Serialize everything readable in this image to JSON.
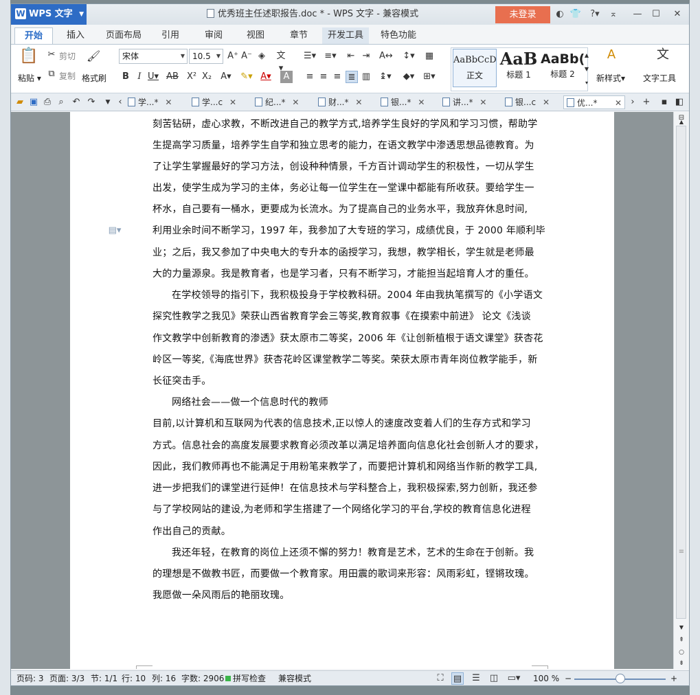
{
  "titlebar": {
    "app_name": "WPS 文字",
    "doc_title": "优秀班主任述职报告.doc * - WPS 文字 - 兼容模式",
    "login_label": "未登录"
  },
  "ribbon_tabs": [
    "开始",
    "插入",
    "页面布局",
    "引用",
    "审阅",
    "视图",
    "章节",
    "开发工具",
    "特色功能"
  ],
  "ribbon": {
    "paste_label": "粘贴",
    "cut_label": "剪切",
    "copy_label": "复制",
    "format_painter_label": "格式刷",
    "font_name": "宋体",
    "font_size": "10.5",
    "style_normal_preview": "AaBbCcD",
    "style_normal_label": "正文",
    "style_h1_preview": "AaB",
    "style_h1_label": "标题 1",
    "style_h2_preview": "AaBb(",
    "style_h2_label": "标题 2",
    "new_style_label": "新样式",
    "text_tools_label": "文字工具"
  },
  "doc_tabs": [
    "学...*",
    "学...c",
    "纪...*",
    "财...*",
    "银...*",
    "讲...*",
    "银...c",
    "优...*"
  ],
  "document": {
    "lines": [
      "刻苦钻研，虚心求教，不断改进自己的教学方式,培养学生良好的学风和学习习惯，帮助学",
      "生提高学习质量，培养学生自学和独立思考的能力，在语文教学中渗透思想品德教育。为",
      "了让学生掌握最好的学习方法，创设种种情景，千方百计调动学生的积极性，一切从学生",
      "出发，使学生成为学习的主体，务必让每一位学生在一堂课中都能有所收获。要给学生一",
      "杯水，自己要有一桶水，更要成为长流水。为了提高自己的业务水平，我放弃休息时间,",
      "利用业余时间不断学习，1997 年，我参加了大专班的学习，成绩优良，于 2000 年顺利毕",
      "业；之后，我又参加了中央电大的专升本的函授学习，我想，教学相长，学生就是老师最",
      "大的力量源泉。我是教育者，也是学习者，只有不断学习，才能担当起培育人才的重任。",
      "在学校领导的指引下，我积极投身于学校教科研。2004 年由我执笔撰写的《小学语文",
      "探究性教学之我见》荣获山西省教育学会三等奖,教育叙事《在摸索中前进》 论文《浅谈",
      "作文教学中创新教育的渗透》获太原市二等奖，2006 年《让创新植根于语文课堂》获杏花",
      "岭区一等奖,《海底世界》获杏花岭区课堂教学二等奖。荣获太原市青年岗位教学能手，新",
      "长征突击手。",
      "网络社会——做一个信息时代的教师",
      "目前,以计算机和互联网为代表的信息技术,正以惊人的速度改变着人们的生存方式和学习",
      "方式。信息社会的高度发展要求教育必须改革以满足培养面向信息化社会创新人才的要求，",
      "因此，我们教师再也不能满足于用粉笔来教学了，而要把计算机和网络当作新的教学工具,",
      "进一步把我们的课堂进行延伸！在信息技术与学科整合上，我积极探索,努力创新，我还参",
      "与了学校网站的建设,为老师和学生搭建了一个网络化学习的平台,学校的教育信息化进程",
      "作出自己的贡献。",
      "我还年轻，在教育的岗位上还须不懈的努力！教育是艺术，艺术的生命在于创新。我",
      "的理想是不做教书匠，而要做一个教育家。用田震的歌词来形容：风雨彩虹，铿锵玫瑰。",
      "我愿做一朵风雨后的艳丽玫瑰。"
    ]
  },
  "statusbar": {
    "page_code": "页码: 3",
    "pages": "页面: 3/3",
    "section": "节: 1/1",
    "row": "行: 10",
    "col": "列: 16",
    "word_count": "字数: 2906",
    "spellcheck": "拼写检查",
    "compat_mode": "兼容模式",
    "zoom": "100 %"
  },
  "colors": {
    "accent": "#2e6cc5",
    "login": "#e86f4f"
  }
}
